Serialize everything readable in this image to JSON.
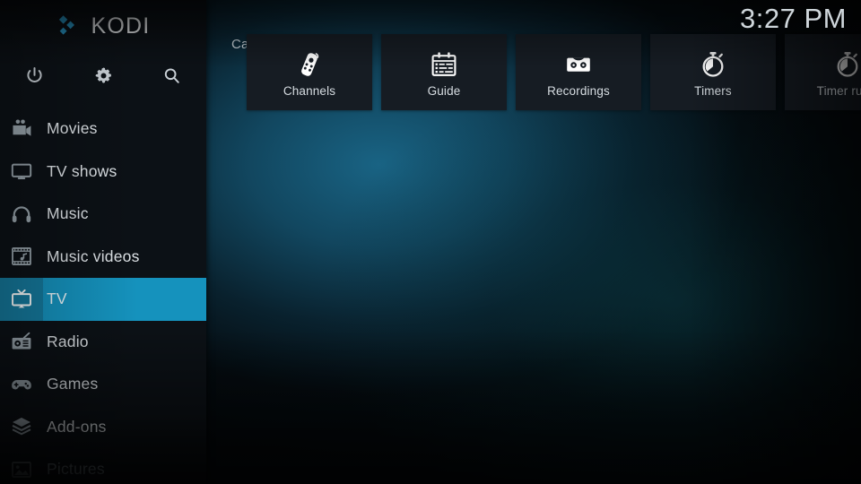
{
  "app": {
    "brand": "KODI",
    "logo_icon": "kodi-logo-icon",
    "accent_color": "#1592bd",
    "accent_dark_color": "#157a9e",
    "sidebar_color": "#0c1116",
    "tile_color": "#161c23"
  },
  "header": {
    "clock": "3:27 PM"
  },
  "toolbar": {
    "items": [
      {
        "name": "power-icon",
        "label": "Power"
      },
      {
        "name": "gear-icon",
        "label": "Settings"
      },
      {
        "name": "search-icon",
        "label": "Search"
      }
    ]
  },
  "sidebar": {
    "items": [
      {
        "label": "Movies",
        "icon": "movie-camera-icon",
        "selected": false,
        "dim": false
      },
      {
        "label": "TV shows",
        "icon": "tv-monitor-icon",
        "selected": false,
        "dim": false
      },
      {
        "label": "Music",
        "icon": "headphones-icon",
        "selected": false,
        "dim": false
      },
      {
        "label": "Music videos",
        "icon": "film-note-icon",
        "selected": false,
        "dim": false
      },
      {
        "label": "TV",
        "icon": "tv-antenna-icon",
        "selected": true,
        "dim": false
      },
      {
        "label": "Radio",
        "icon": "radio-icon",
        "selected": false,
        "dim": false
      },
      {
        "label": "Games",
        "icon": "gamepad-icon",
        "selected": false,
        "dim": false
      },
      {
        "label": "Add-ons",
        "icon": "addon-box-icon",
        "selected": false,
        "dim": false
      },
      {
        "label": "Pictures",
        "icon": "picture-icon",
        "selected": false,
        "dim": true
      }
    ]
  },
  "main": {
    "section_title": "Categories",
    "tiles": [
      {
        "label": "Channels",
        "icon": "remote-control-icon"
      },
      {
        "label": "Guide",
        "icon": "calendar-guide-icon"
      },
      {
        "label": "Recordings",
        "icon": "cassette-tape-icon"
      },
      {
        "label": "Timers",
        "icon": "stopwatch-icon"
      },
      {
        "label": "Timer rules",
        "icon": "stopwatch-icon"
      }
    ]
  }
}
